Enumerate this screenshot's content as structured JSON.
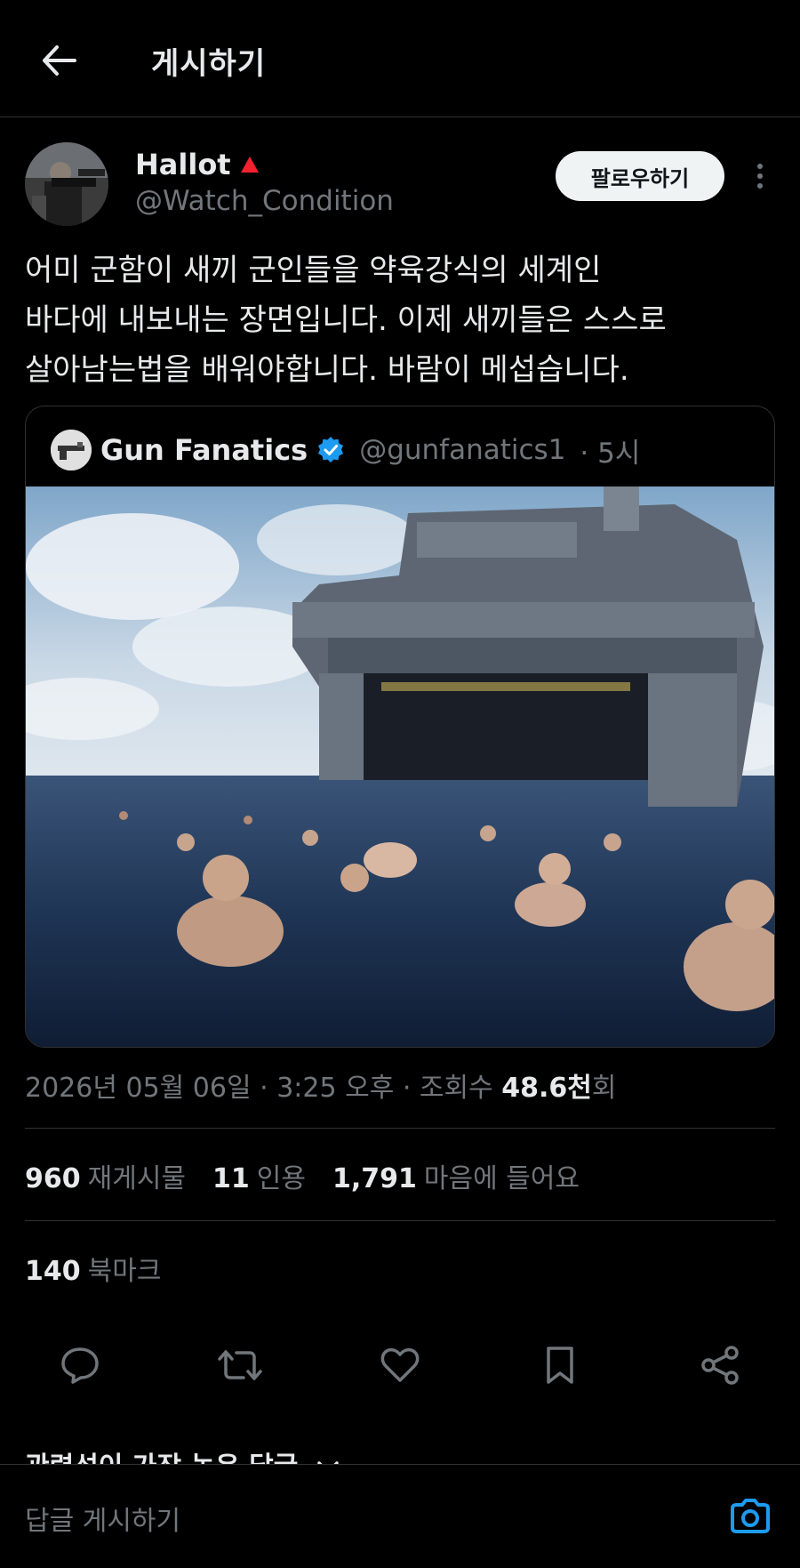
{
  "header": {
    "title": "게시하기"
  },
  "author": {
    "display_name": "Hallot",
    "handle": "@Watch_Condition",
    "badge_color": "#f4212e",
    "follow_label": "팔로우하기"
  },
  "post": {
    "lines": [
      "어미 군함이 새끼 군인들을 약육강식의 세계인",
      "바다에 내보내는 장면입니다. 이제 새끼들은 스스로",
      "살아남는법을 배워야합니다. 바람이 메섭습니다."
    ]
  },
  "quote": {
    "name": "Gun Fanatics",
    "handle": "@gunfanatics1",
    "time": "· 5시",
    "verified_color": "#1d9bf0"
  },
  "meta": {
    "date": "2026년 05월 06일",
    "time": "· 3:25 오후 · 조회수",
    "views": "48.6천",
    "views_suffix": "회"
  },
  "stats": {
    "reposts_count": "960",
    "reposts_label": "재게시물",
    "quotes_count": "11",
    "quotes_label": "인용",
    "likes_count": "1,791",
    "likes_label": "마음에 들어요",
    "bookmarks_count": "140",
    "bookmarks_label": "북마크"
  },
  "replies": {
    "sort_label": "관련성이 가장 높은 답글"
  },
  "composer": {
    "placeholder": "답글 게시하기",
    "accent_color": "#1d9bf0"
  },
  "icons": [
    "back-arrow-icon",
    "more-icon",
    "verified-icon",
    "reply-icon",
    "repost-icon",
    "like-icon",
    "bookmark-icon",
    "share-icon",
    "camera-icon",
    "chevron-down-icon"
  ]
}
